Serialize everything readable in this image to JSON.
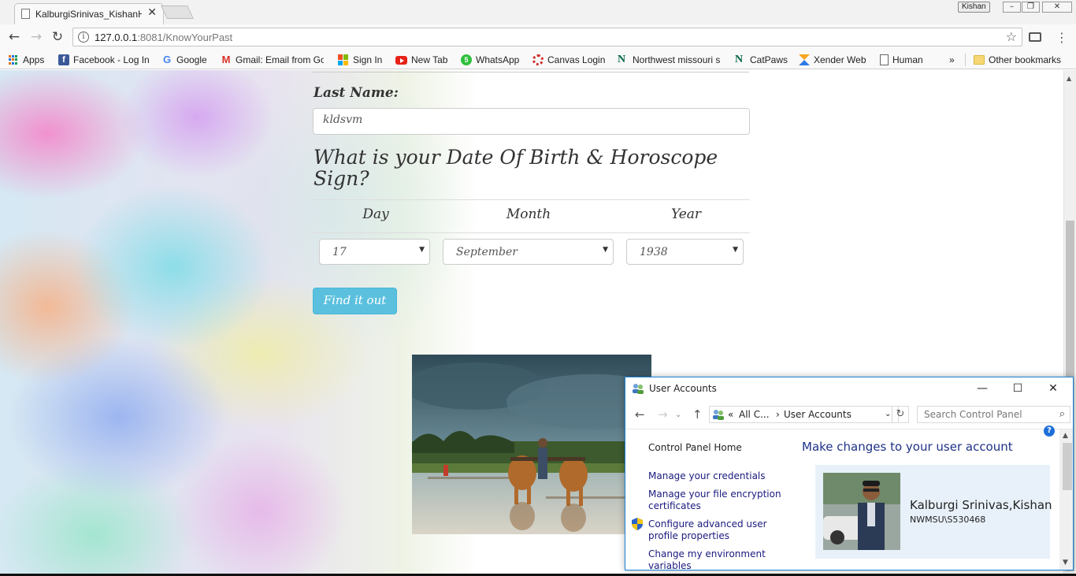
{
  "browser": {
    "tab_title": "KalburgiSrinivas_KishanH",
    "profile_name": "Kishan",
    "url_host": "127.0.0.1",
    "url_rest": ":8081/KnowYourPast",
    "bookmarks": [
      {
        "label": "Apps",
        "icon": "apps-grid-icon"
      },
      {
        "label": "Facebook - Log In",
        "icon": "facebook-icon"
      },
      {
        "label": "Google",
        "icon": "google-icon"
      },
      {
        "label": "Gmail: Email from Go",
        "icon": "gmail-icon"
      },
      {
        "label": "Sign In",
        "icon": "microsoft-icon"
      },
      {
        "label": "New Tab",
        "icon": "youtube-icon"
      },
      {
        "label": "WhatsApp",
        "icon": "whatsapp-icon"
      },
      {
        "label": "Canvas Login",
        "icon": "canvas-icon"
      },
      {
        "label": "Northwest missouri s",
        "icon": "northwest-icon"
      },
      {
        "label": "CatPaws",
        "icon": "northwest-icon"
      },
      {
        "label": "Xender Web",
        "icon": "xender-icon"
      },
      {
        "label": "Human",
        "icon": "page-icon"
      }
    ],
    "overflow_label": "»",
    "other_bookmarks": "Other bookmarks"
  },
  "form": {
    "last_name_label": "Last Name:",
    "last_name_value": "kldsvm",
    "dob_heading": "What is your Date Of Birth & Horoscope Sign?",
    "columns": {
      "day": "Day",
      "month": "Month",
      "year": "Year"
    },
    "day_value": "17",
    "month_value": "September",
    "year_value": "1938",
    "submit_label": "Find it out"
  },
  "user_accounts": {
    "window_title": "User Accounts",
    "breadcrumb_prefix": "«",
    "breadcrumb_parent": "All C...",
    "breadcrumb_sep": "›",
    "breadcrumb_current": "User Accounts",
    "search_placeholder": "Search Control Panel",
    "links": [
      "Control Panel Home",
      "Manage your credentials",
      "Manage your file encryption certificates",
      "Configure advanced user profile properties",
      "Change my environment variables"
    ],
    "main_title": "Make changes to your user account",
    "user_name": "Kalburgi Srinivas,Kishan",
    "user_id": "NWMSU\\S530468"
  },
  "colors": {
    "button_bg": "#5bc0de",
    "link_color": "#1a1a7e",
    "window_border": "#1883d7",
    "title_blue": "#1e3287"
  }
}
